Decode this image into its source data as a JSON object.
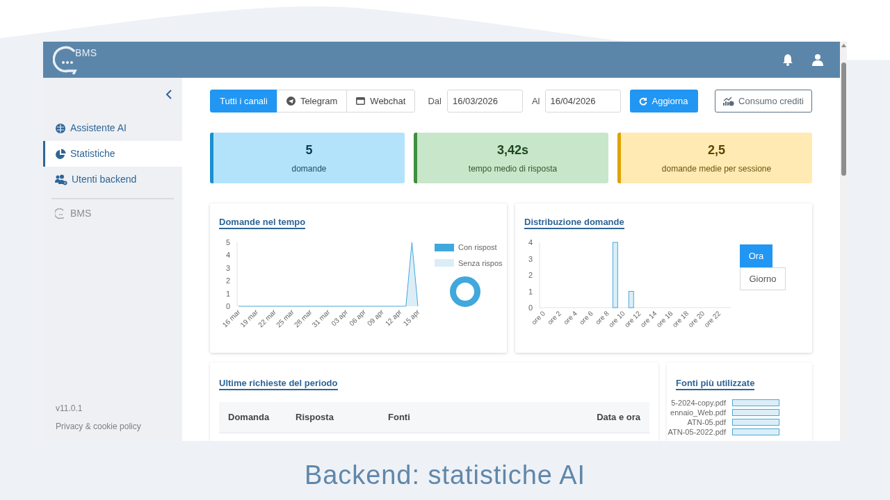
{
  "caption": "Backend: statistiche AI",
  "header": {
    "logo_text": "BMS"
  },
  "sidebar": {
    "items": [
      {
        "label": "Assistente AI",
        "selected": false
      },
      {
        "label": "Statistiche",
        "selected": true
      },
      {
        "label": "Utenti backend",
        "selected": false
      }
    ],
    "brand": "BMS",
    "version": "v11.0.1",
    "privacy_link": "Privacy & cookie policy"
  },
  "toolbar": {
    "channels": [
      {
        "label": "Tutti i canali",
        "selected": true
      },
      {
        "label": "Telegram",
        "selected": false
      },
      {
        "label": "Webchat",
        "selected": false
      }
    ],
    "from_label": "Dal",
    "from_value": "16/03/2026",
    "to_label": "Al",
    "to_value": "16/04/2026",
    "refresh_button": "Aggiorna",
    "credits_button": "Consumo crediti"
  },
  "stats": [
    {
      "value": "5",
      "label": "domande",
      "kind": "info"
    },
    {
      "value": "3,42s",
      "label": "tempo medio di risposta",
      "kind": "success"
    },
    {
      "value": "2,5",
      "label": "domande medie per sessione",
      "kind": "warning"
    }
  ],
  "questions_over_time": {
    "title": "Domande nel tempo",
    "chart_data": {
      "type": "area",
      "categories": [
        "16 mar",
        null,
        null,
        "19 mar",
        null,
        null,
        "22 mar",
        null,
        null,
        "25 mar",
        null,
        null,
        "28 mar",
        null,
        null,
        "31 mar",
        null,
        null,
        "03 apr",
        null,
        null,
        "06 apr",
        null,
        null,
        "09 apr",
        null,
        null,
        "12 apr",
        null,
        null,
        "15 apr"
      ],
      "series": [
        {
          "name": "Con rispost",
          "color": "#40a8dc",
          "values": [
            0,
            0,
            0,
            0,
            0,
            0,
            0,
            0,
            0,
            0,
            0,
            0,
            0,
            0,
            0,
            0,
            0,
            0,
            0,
            0,
            0,
            0,
            0,
            0,
            0,
            0,
            0,
            0,
            0,
            5,
            0
          ]
        }
      ],
      "ylim": [
        0,
        5
      ],
      "yticks": [
        0,
        1,
        2,
        3,
        4,
        5
      ]
    },
    "legend_extra": [
      {
        "label": "Senza rispos",
        "color": "#dbeef8"
      }
    ]
  },
  "distribution": {
    "title": "Distribuzione domande",
    "toggle": [
      {
        "label": "Ora",
        "selected": true
      },
      {
        "label": "Giorno",
        "selected": false
      }
    ],
    "chart_data": {
      "type": "bar",
      "categories": [
        "ore 0",
        null,
        "ore 2",
        null,
        "ore 4",
        null,
        "ore 6",
        null,
        "ore 8",
        null,
        "ore 10",
        null,
        "ore 12",
        null,
        "ore 14",
        null,
        "ore 16",
        null,
        "ore 18",
        null,
        "ore 20",
        null,
        "ore 22",
        null
      ],
      "values": [
        0,
        0,
        0,
        0,
        0,
        0,
        0,
        0,
        0,
        4,
        0,
        1,
        0,
        0,
        0,
        0,
        0,
        0,
        0,
        0,
        0,
        0,
        0,
        0
      ],
      "ylim": [
        0,
        4
      ],
      "yticks": [
        0,
        1,
        2,
        3,
        4
      ]
    }
  },
  "recent_requests": {
    "title": "Ultime richieste del periodo",
    "columns": [
      "Domanda",
      "Risposta",
      "Fonti",
      "Data e ora"
    ]
  },
  "top_sources": {
    "title": "Fonti più utilizzate",
    "items": [
      "5-2024-copy.pdf",
      "ennaio_Web.pdf",
      "ATN-05.pdf",
      "ATN-05-2022.pdf"
    ]
  }
}
